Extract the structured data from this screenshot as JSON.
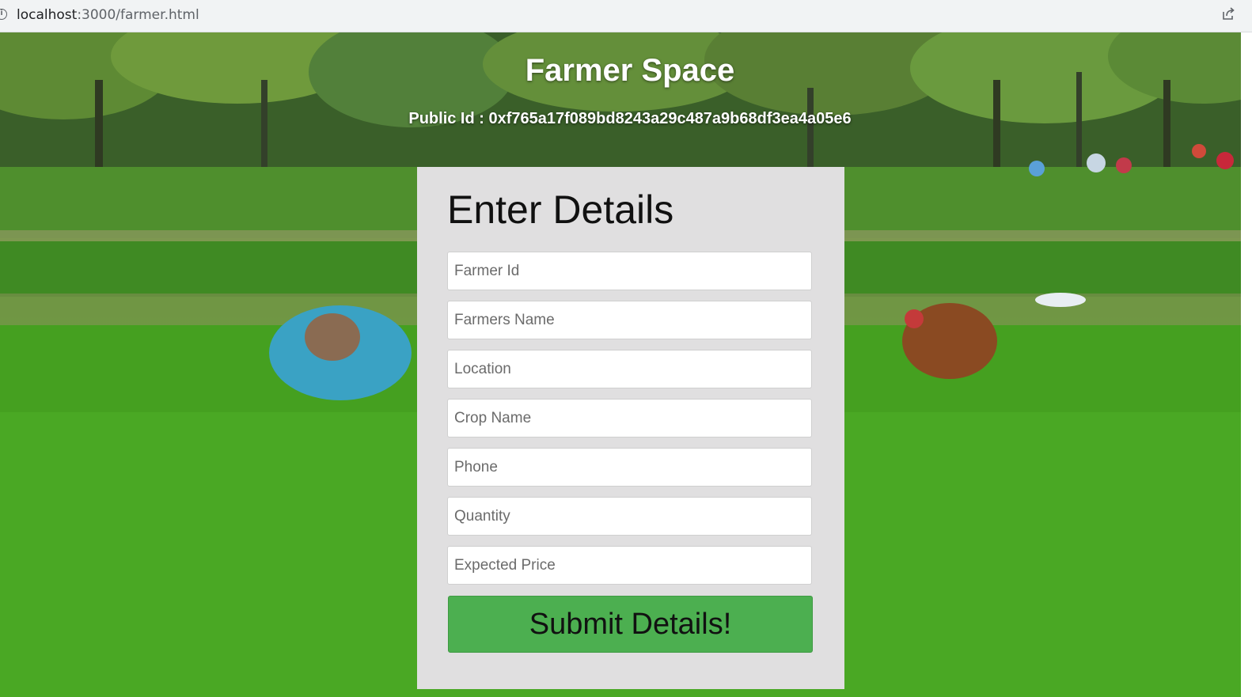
{
  "browser": {
    "url_host": "localhost",
    "url_path": ":3000/farmer.html"
  },
  "header": {
    "title": "Farmer Space",
    "public_id": "Public Id : 0xf765a17f089bd8243a29c487a9b68df3ea4a05e6"
  },
  "form": {
    "heading": "Enter Details",
    "fields": [
      {
        "placeholder": "Farmer Id"
      },
      {
        "placeholder": "Farmers Name"
      },
      {
        "placeholder": "Location"
      },
      {
        "placeholder": "Crop Name"
      },
      {
        "placeholder": "Phone"
      },
      {
        "placeholder": "Quantity"
      },
      {
        "placeholder": "Expected Price"
      }
    ],
    "submit_label": "Submit Details!"
  },
  "colors": {
    "submit_button": "#4caf50",
    "card_background": "#e0dfe0",
    "field_background": "#ffffff"
  },
  "icons": {
    "address_info": "info-icon",
    "address_share": "share-icon"
  }
}
